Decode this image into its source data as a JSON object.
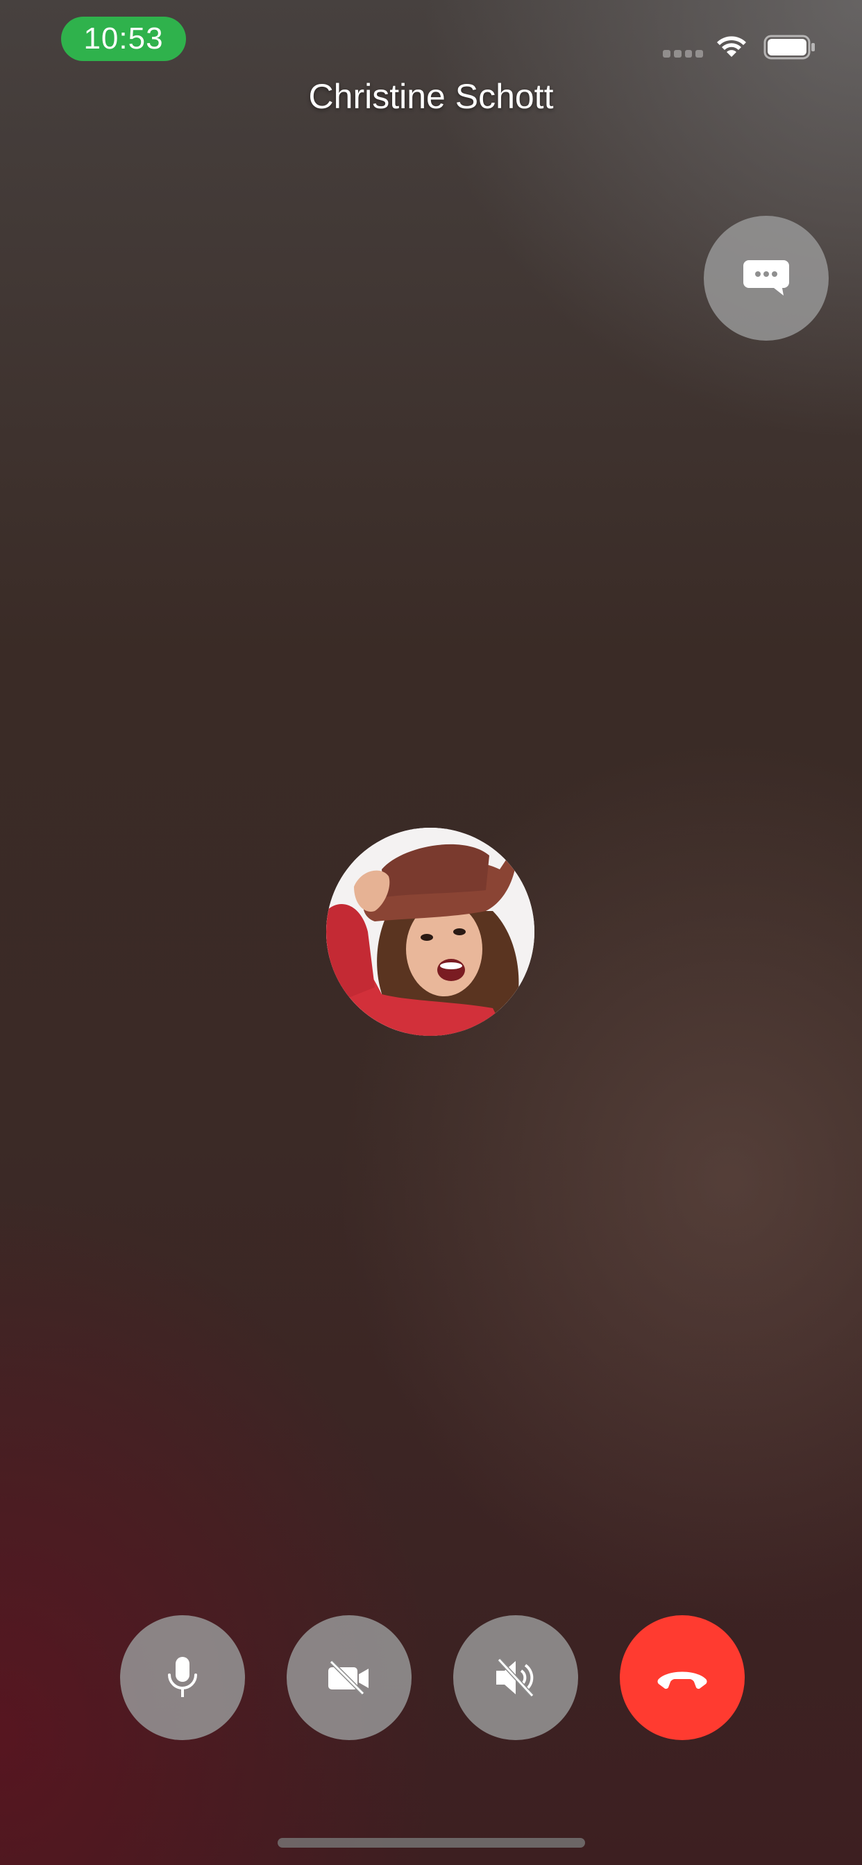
{
  "status_bar": {
    "time": "10:53",
    "time_pill_color": "#2fb24c",
    "icons": [
      "signal-icon",
      "wifi-icon",
      "battery-icon"
    ]
  },
  "call": {
    "caller_name": "Christine Schott"
  },
  "controls": {
    "chat": {
      "icon": "message-bubble-icon"
    },
    "mute": {
      "icon": "microphone-icon"
    },
    "video": {
      "icon": "video-off-icon"
    },
    "speaker": {
      "icon": "speaker-muted-icon"
    },
    "end_call": {
      "icon": "phone-hangup-icon",
      "color": "#ff3b30"
    }
  }
}
